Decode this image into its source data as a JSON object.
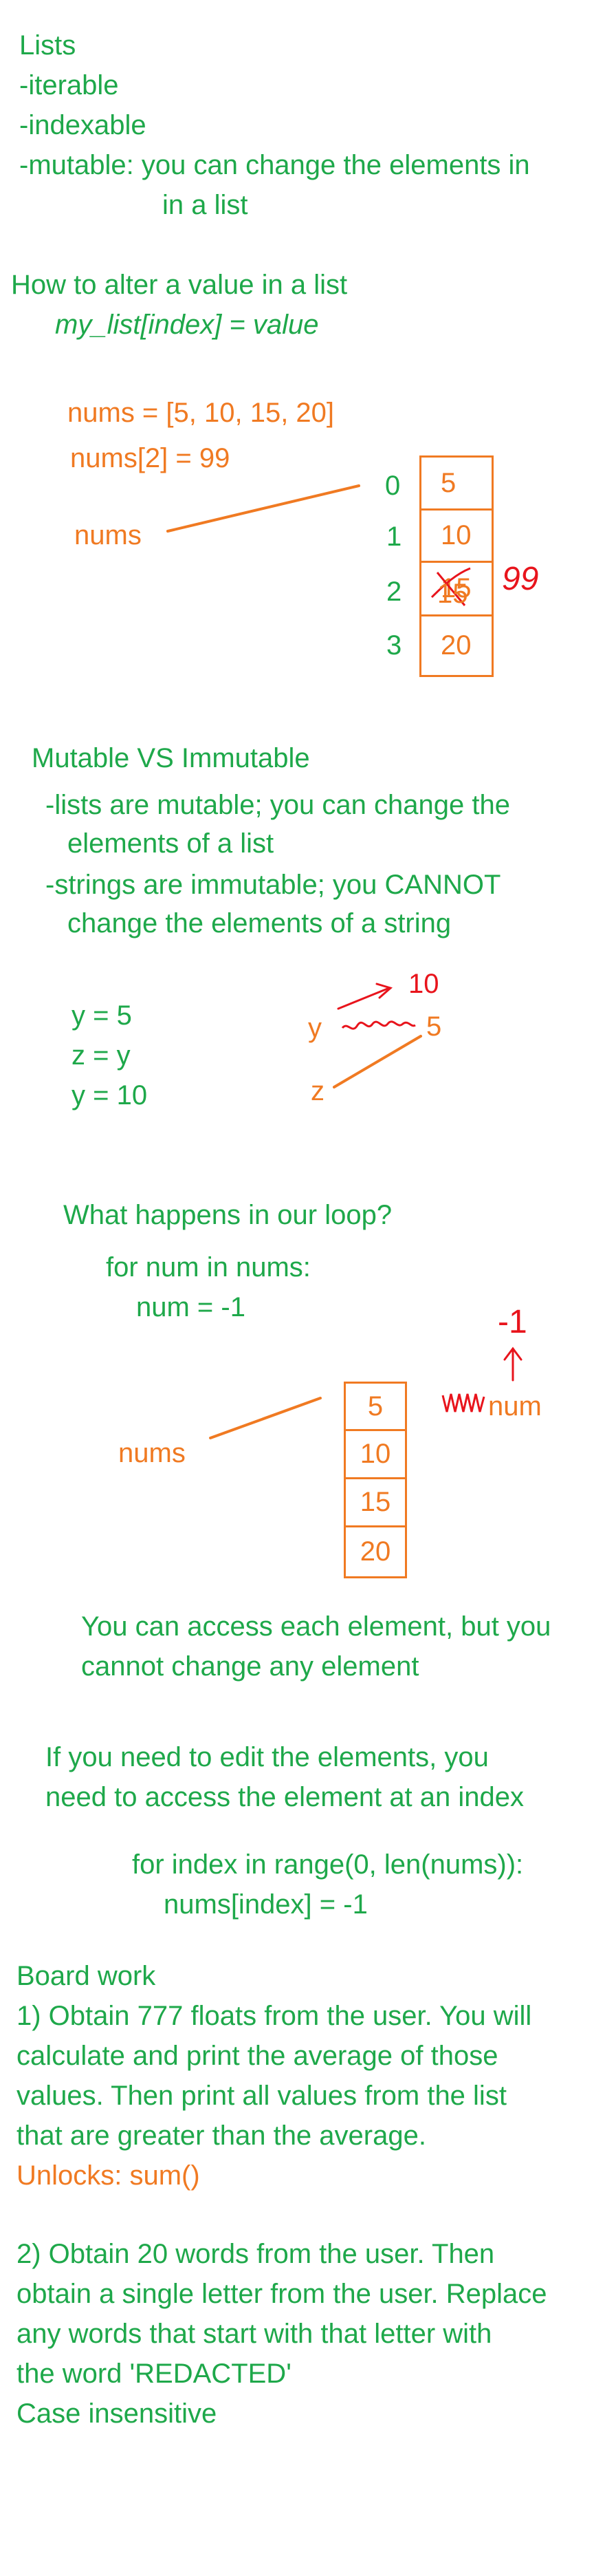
{
  "section1": {
    "title": "Lists",
    "bullet1": "-iterable",
    "bullet2": "-indexable",
    "bullet3": "-mutable: you can change the elements in",
    "bullet3_cont": "in a list"
  },
  "alter": {
    "heading": "How to alter a value in a list",
    "syntax": "my_list[index] = value",
    "code1": "nums = [5, 10, 15, 20]",
    "code2": "nums[2] = 99",
    "var_label": "nums",
    "indices": [
      "0",
      "1",
      "2",
      "3"
    ],
    "cells": [
      "5",
      "10",
      "15",
      "20"
    ],
    "handwritten_new_value": "99"
  },
  "mutable": {
    "heading": "Mutable VS Immutable",
    "line1": "-lists are mutable; you can change the",
    "line1_cont": "elements of a list",
    "line2": "-strings are immutable; you CANNOT",
    "line2_cont": "change the elements of a string"
  },
  "assign": {
    "line1": "y = 5",
    "line2": "z = y",
    "line3": "y = 10",
    "var_y": "y",
    "var_z": "z",
    "value5": "5",
    "handwritten_10": "10"
  },
  "loop": {
    "heading": "What happens in our loop?",
    "code1": "for num in nums:",
    "code2": "num = -1",
    "var_label": "nums",
    "cells": [
      "5",
      "10",
      "15",
      "20"
    ],
    "num_label": "num",
    "handwritten_neg1": "-1"
  },
  "access": {
    "line1": "You can access each element, but you",
    "line2": "cannot change any element"
  },
  "edit": {
    "line1": "If you need to edit the elements, you",
    "line2": "need to access the element at an index",
    "code1": "for index in range(0, len(nums)):",
    "code2": "nums[index] = -1"
  },
  "board": {
    "heading": "Board work",
    "p1_l1": "1) Obtain 777 floats from the user. You will",
    "p1_l2": "calculate and print the average of those",
    "p1_l3": "values. Then print all values from the list",
    "p1_l4": "that are greater than the average.",
    "unlocks": "Unlocks: sum()",
    "p2_l1": "2) Obtain 20 words from the user. Then",
    "p2_l2": "obtain a single letter from the user. Replace",
    "p2_l3": "any words that start with that letter with",
    "p2_l4": "the word 'REDACTED'",
    "p2_l5": "Case insensitive"
  },
  "colors": {
    "green": "#1ea84a",
    "orange": "#f07a22",
    "red": "#e8141c"
  }
}
